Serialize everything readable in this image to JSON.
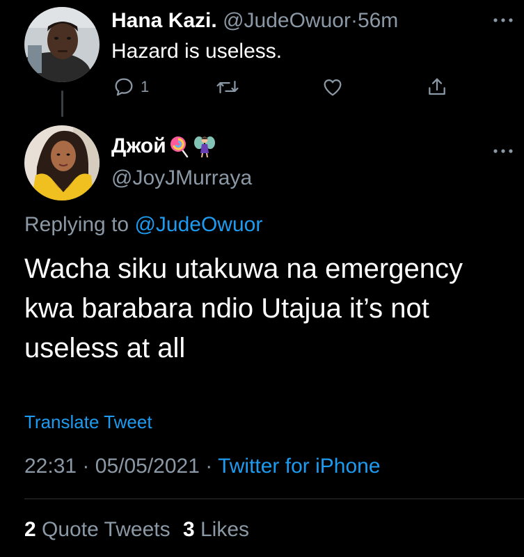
{
  "parent_tweet": {
    "display_name": "Hana Kazi.",
    "handle": "@JudeOwuor",
    "separator": "·",
    "time": "56m",
    "text": "Hazard is useless.",
    "reply_count": "1"
  },
  "reply_tweet": {
    "display_name": "Джой",
    "handle": "@JoyJMurraya",
    "replying_prefix": "Replying to",
    "replying_handle": "@JudeOwuor",
    "text": "Wacha siku utakuwa na emergency kwa barabara ndio Utajua it’s not useless at all",
    "translate_label": "Translate Tweet",
    "time": "22:31",
    "separator": "·",
    "date": "05/05/2021",
    "source": "Twitter for iPhone",
    "quote_tweets_count": "2",
    "quote_tweets_label": "Quote Tweets",
    "likes_count": "3",
    "likes_label": "Likes"
  },
  "icons": {
    "reply": "reply-icon",
    "retweet": "retweet-icon",
    "like": "heart-icon",
    "share": "share-icon",
    "more": "more-icon",
    "name_emoji_1": "lollipop-icon",
    "name_emoji_2": "fairy-icon"
  },
  "colors": {
    "background": "#000000",
    "text": "#ffffff",
    "muted": "#8b98a5",
    "link": "#1d9bf0",
    "divider": "#2f3336"
  }
}
